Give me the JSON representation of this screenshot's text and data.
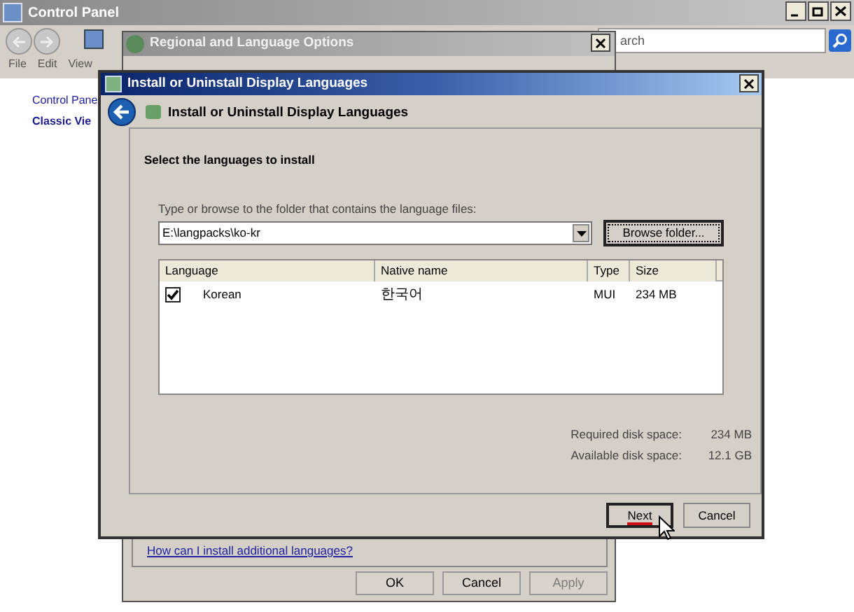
{
  "control_panel": {
    "title": "Control Panel",
    "search": {
      "placeholder": "arch"
    },
    "menu": [
      "File",
      "Edit",
      "View"
    ],
    "sidebar": [
      {
        "label": "Control Pane",
        "kind": "link"
      },
      {
        "label": "Classic Vie",
        "kind": "heading"
      }
    ]
  },
  "regional_dialog": {
    "title": "Regional and Language Options",
    "help_link": "How can I install additional languages?",
    "buttons": [
      {
        "label": "OK",
        "disabled": false
      },
      {
        "label": "Cancel",
        "disabled": false
      },
      {
        "label": "Apply",
        "disabled": true
      }
    ]
  },
  "install_dialog": {
    "title": "Install or Uninstall Display Languages",
    "header": "Install or Uninstall Display Languages",
    "instruction": "Select the languages to install",
    "folder_label": "Type or browse to the folder that contains the language files:",
    "folder": {
      "value": "E:\\langpacks\\ko-kr"
    },
    "browse_button": "Browse folder...",
    "table": {
      "columns": [
        "Language",
        "Native name",
        "Type",
        "Size"
      ],
      "rows": [
        {
          "checked": true,
          "cells": [
            "Korean",
            "한국어",
            "MUI",
            "234 MB"
          ]
        }
      ]
    },
    "disk_space": [
      {
        "label": "Required disk space:",
        "value": "234 MB"
      },
      {
        "label": "Available disk space:",
        "value": "12.1 GB"
      }
    ],
    "buttons": [
      {
        "label": "Next",
        "focused": true
      },
      {
        "label": "Cancel",
        "focused": false
      }
    ]
  }
}
